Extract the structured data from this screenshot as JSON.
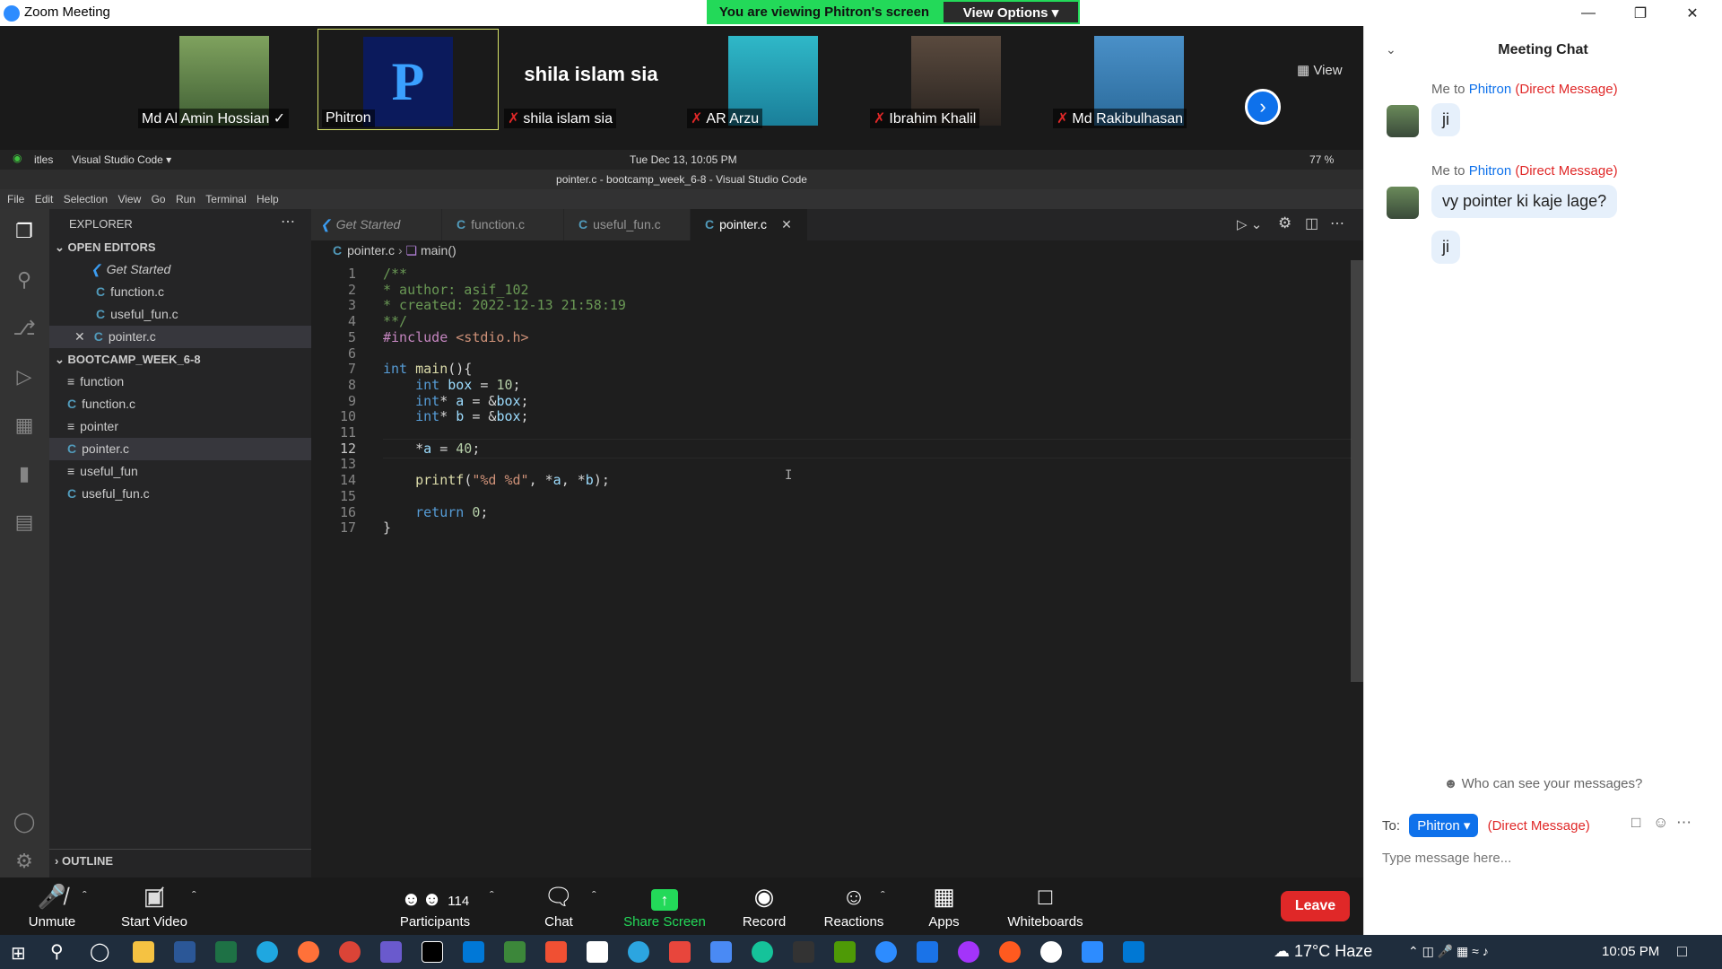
{
  "zoom": {
    "window_title": "Zoom Meeting",
    "banner_text": "You are viewing Phitron's screen",
    "view_options": "View Options ▾",
    "view_label": "View",
    "participants_tiles": [
      {
        "name": "Md Al Amin Hossian ✓",
        "muted": false,
        "has_photo": true
      },
      {
        "name": "Phitron",
        "muted": false,
        "has_photo": true,
        "logo": true
      },
      {
        "name": "shila islam sia",
        "muted": true,
        "has_photo": false,
        "big_name": "shila islam sia"
      },
      {
        "name": "AR Arzu",
        "muted": true,
        "has_photo": true
      },
      {
        "name": "Ibrahim Khalil",
        "muted": true,
        "has_photo": true
      },
      {
        "name": "Md Rakibulhasan",
        "muted": true,
        "has_photo": true
      }
    ],
    "toolbar": {
      "unmute": "Unmute",
      "start_video": "Start Video",
      "participants": "Participants",
      "participants_count": "114",
      "chat": "Chat",
      "share_screen": "Share Screen",
      "record": "Record",
      "reactions": "Reactions",
      "apps": "Apps",
      "whiteboards": "Whiteboards",
      "leave": "Leave"
    }
  },
  "ubuntu": {
    "activities": "itles",
    "app_menu": "Visual Studio Code ▾",
    "datetime": "Tue Dec 13, 10:05 PM",
    "battery": "77 %"
  },
  "vscode": {
    "window_title": "pointer.c - bootcamp_week_6-8 - Visual Studio Code",
    "menu": [
      "File",
      "Edit",
      "Selection",
      "View",
      "Go",
      "Run",
      "Terminal",
      "Help"
    ],
    "explorer_title": "EXPLORER",
    "open_editors_label": "OPEN EDITORS",
    "open_editors": [
      "Get Started",
      "function.c",
      "useful_fun.c",
      "pointer.c"
    ],
    "folder_label": "BOOTCAMP_WEEK_6-8",
    "files": [
      {
        "name": "function",
        "type": "file"
      },
      {
        "name": "function.c",
        "type": "c"
      },
      {
        "name": "pointer",
        "type": "file"
      },
      {
        "name": "pointer.c",
        "type": "c"
      },
      {
        "name": "useful_fun",
        "type": "file"
      },
      {
        "name": "useful_fun.c",
        "type": "c"
      }
    ],
    "outline_label": "OUTLINE",
    "tabs": [
      "Get Started",
      "function.c",
      "useful_fun.c",
      "pointer.c"
    ],
    "breadcrumb": {
      "file": "pointer.c",
      "symbol": "main()"
    },
    "code_lines": [
      "/**",
      "* author: asif_102",
      "* created: 2022-12-13 21:58:19",
      "**/",
      "#include <stdio.h>",
      "",
      "int main(){",
      "    int box = 10;",
      "    int* a = &box;",
      "    int* b = &box;",
      "",
      "    *a = 40;",
      "",
      "    printf(\"%d %d\", *a, *b);",
      "",
      "    return 0;",
      "}"
    ],
    "current_line": 12
  },
  "chat": {
    "title": "Meeting Chat",
    "messages": [
      {
        "from": "Me to",
        "to": "Phitron",
        "dm": "(Direct Message)",
        "texts": [
          "ji"
        ]
      },
      {
        "from": "Me to",
        "to": "Phitron",
        "dm": "(Direct Message)",
        "texts": [
          "vy pointer ki kaje lage?",
          "ji"
        ]
      }
    ],
    "who_can_see": "Who can see your messages?",
    "to_label": "To:",
    "to_value": "Phitron ▾",
    "to_dm": "(Direct Message)",
    "input_placeholder": "Type message here..."
  },
  "taskbar": {
    "weather": "17°C Haze",
    "clock": "10:05 PM"
  }
}
